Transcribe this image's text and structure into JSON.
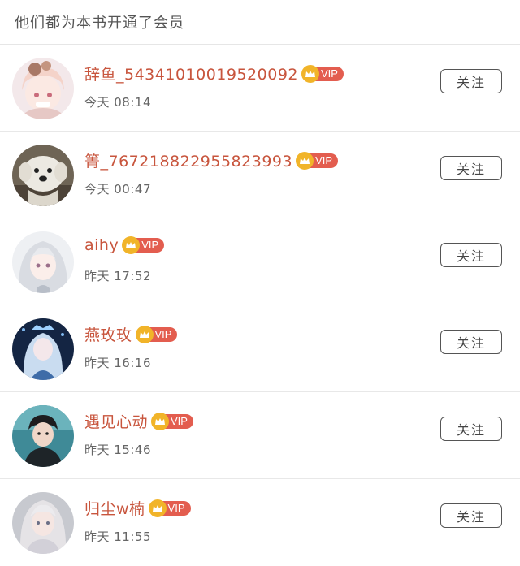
{
  "header": {
    "title": "他们都为本书开通了会员"
  },
  "vip_label": "VIP",
  "colors": {
    "name": "#c8553d",
    "vip_badge": "#e35d4f",
    "crown": "#f1b429"
  },
  "users": [
    {
      "name": "辞鱼_5434101001952009​2",
      "time": "今天 08:14",
      "follow_label": "关注",
      "avatar_icon": "anime-girl-avatar"
    },
    {
      "name": "箐_7672188229558239​93",
      "time": "今天 00:47",
      "follow_label": "关注",
      "avatar_icon": "white-dog-avatar"
    },
    {
      "name": "aihy",
      "time": "昨天 17:52",
      "follow_label": "关注",
      "avatar_icon": "white-hair-anime-avatar"
    },
    {
      "name": "燕玫玫",
      "time": "昨天 16:16",
      "follow_label": "关注",
      "avatar_icon": "blue-princess-avatar"
    },
    {
      "name": "遇见心动",
      "time": "昨天 15:46",
      "follow_label": "关注",
      "avatar_icon": "boy-portrait-avatar"
    },
    {
      "name": "归尘w楠",
      "time": "昨天 11:55",
      "follow_label": "关注",
      "avatar_icon": "silver-hair-girl-avatar"
    }
  ]
}
